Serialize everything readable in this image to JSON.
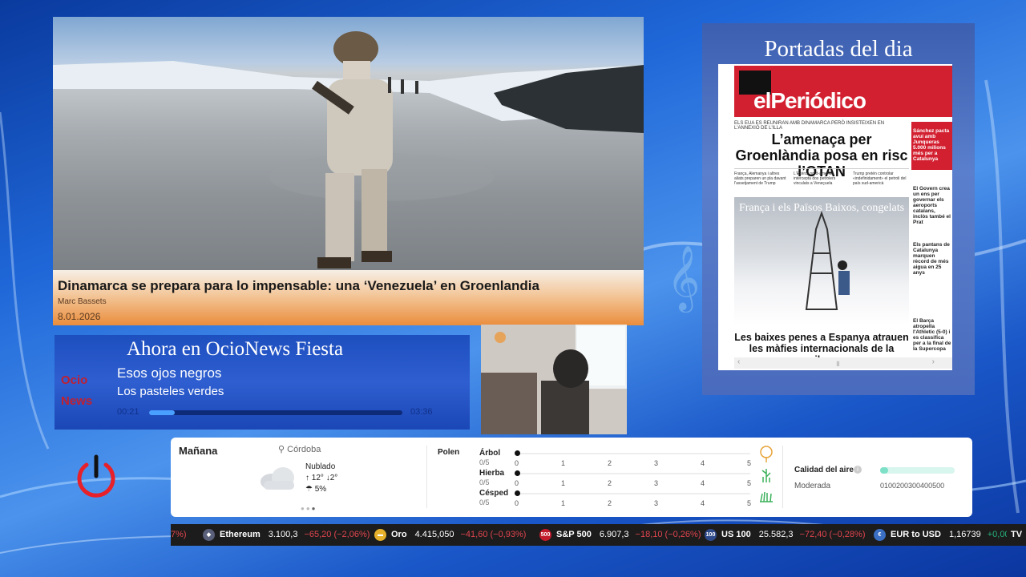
{
  "news": {
    "title": "Dinamarca se prepara para lo impensable: una ‘Venezuela’ en Groenlandia",
    "author": "Marc Bassets",
    "date": "8.01.2026"
  },
  "portadas": {
    "title": "Portadas del dia",
    "paper": {
      "logo": "elPeriódico",
      "kicker": "ELS EUA ES REUNIRAN AMB DINAMARCA PERÒ INSISTEIXEN EN L'ANNEXIÓ DE L'ILLA",
      "headline": "L’amenaça per Groenlàndia posa en risc l’OTAN",
      "col1": "França, Alemanya i altres aliats preparen un pla davant l'assetjament de Trump",
      "col2": "L'Exèrcit nord-americà intercepta dos petrolers vinculats a Veneçuela",
      "col3": "Trump pretén controlar «indefinidament» el petroli del país sud-americà",
      "side1": "Sánchez pacta avui amb Junqueras 5.000 milions més per a Catalunya",
      "side2": "El Govern crea un ens per governar els aeroports catalans, inclòs també el Prat",
      "side3": "Els pantans de Catalunya marquen rècord de més aigua en 25 anys",
      "side4": "El Barça atropella l'Athletic (5-0) i es classifica per a la final de la Supercopa",
      "photo_title": "França i els Països Baixos, congelats",
      "bottom": "Les baixes penes a Espanya atrauen les màfies internacionals de la marihuana"
    }
  },
  "radio": {
    "heading": "Ahora en OcioNews Fiesta",
    "logo_top": "Ocio",
    "logo_bottom": "News",
    "song": "Esos ojos negros",
    "artist": "Los pasteles verdes",
    "elapsed": "00:21",
    "duration": "03:36",
    "progress": 0.1
  },
  "weather": {
    "title": "Mañana",
    "location": "Córdoba",
    "condition": "Nublado",
    "high": "12°",
    "low": "2°",
    "rain": "5%",
    "pollen": {
      "label": "Polen",
      "items": [
        {
          "name": "Árbol",
          "value": "0/5",
          "level": 0
        },
        {
          "name": "Hierba",
          "value": "0/5",
          "level": 0
        },
        {
          "name": "Césped",
          "value": "0/5",
          "level": 0
        }
      ],
      "scale": [
        "0",
        "1",
        "2",
        "3",
        "4",
        "5"
      ]
    },
    "air": {
      "label": "Calidad del aire",
      "value": "Moderada",
      "scale": "0100200300400500"
    }
  },
  "ticker": [
    {
      "name": "",
      "price": "",
      "change": "7%)",
      "dir": "down",
      "icon": ""
    },
    {
      "name": "Ethereum",
      "price": "3.100,3",
      "change": "−65,20 (−2,06%)",
      "dir": "down",
      "icon": "ethereum-icon"
    },
    {
      "name": "Oro",
      "price": "4.415,050",
      "change": "−41,60 (−0,93%)",
      "dir": "down",
      "icon": "gold-icon"
    },
    {
      "name": "S&P 500",
      "price": "6.907,3",
      "change": "−18,10 (−0,26%)",
      "dir": "down",
      "icon": "sp500-icon",
      "badge": "500"
    },
    {
      "name": "US 100",
      "price": "25.582,3",
      "change": "−72,40 (−0,28%)",
      "dir": "down",
      "icon": "us100-icon",
      "badge": "100"
    },
    {
      "name": "EUR to USD",
      "price": "1,16739",
      "change": "+0,00 (+",
      "dir": "up",
      "icon": "eurusd-icon"
    }
  ],
  "ticker_brand": "TV",
  "colors": {
    "accent_orange": "#ea8d3c",
    "brand_red": "#d32030",
    "down": "#e0454e",
    "up": "#26b07a"
  }
}
